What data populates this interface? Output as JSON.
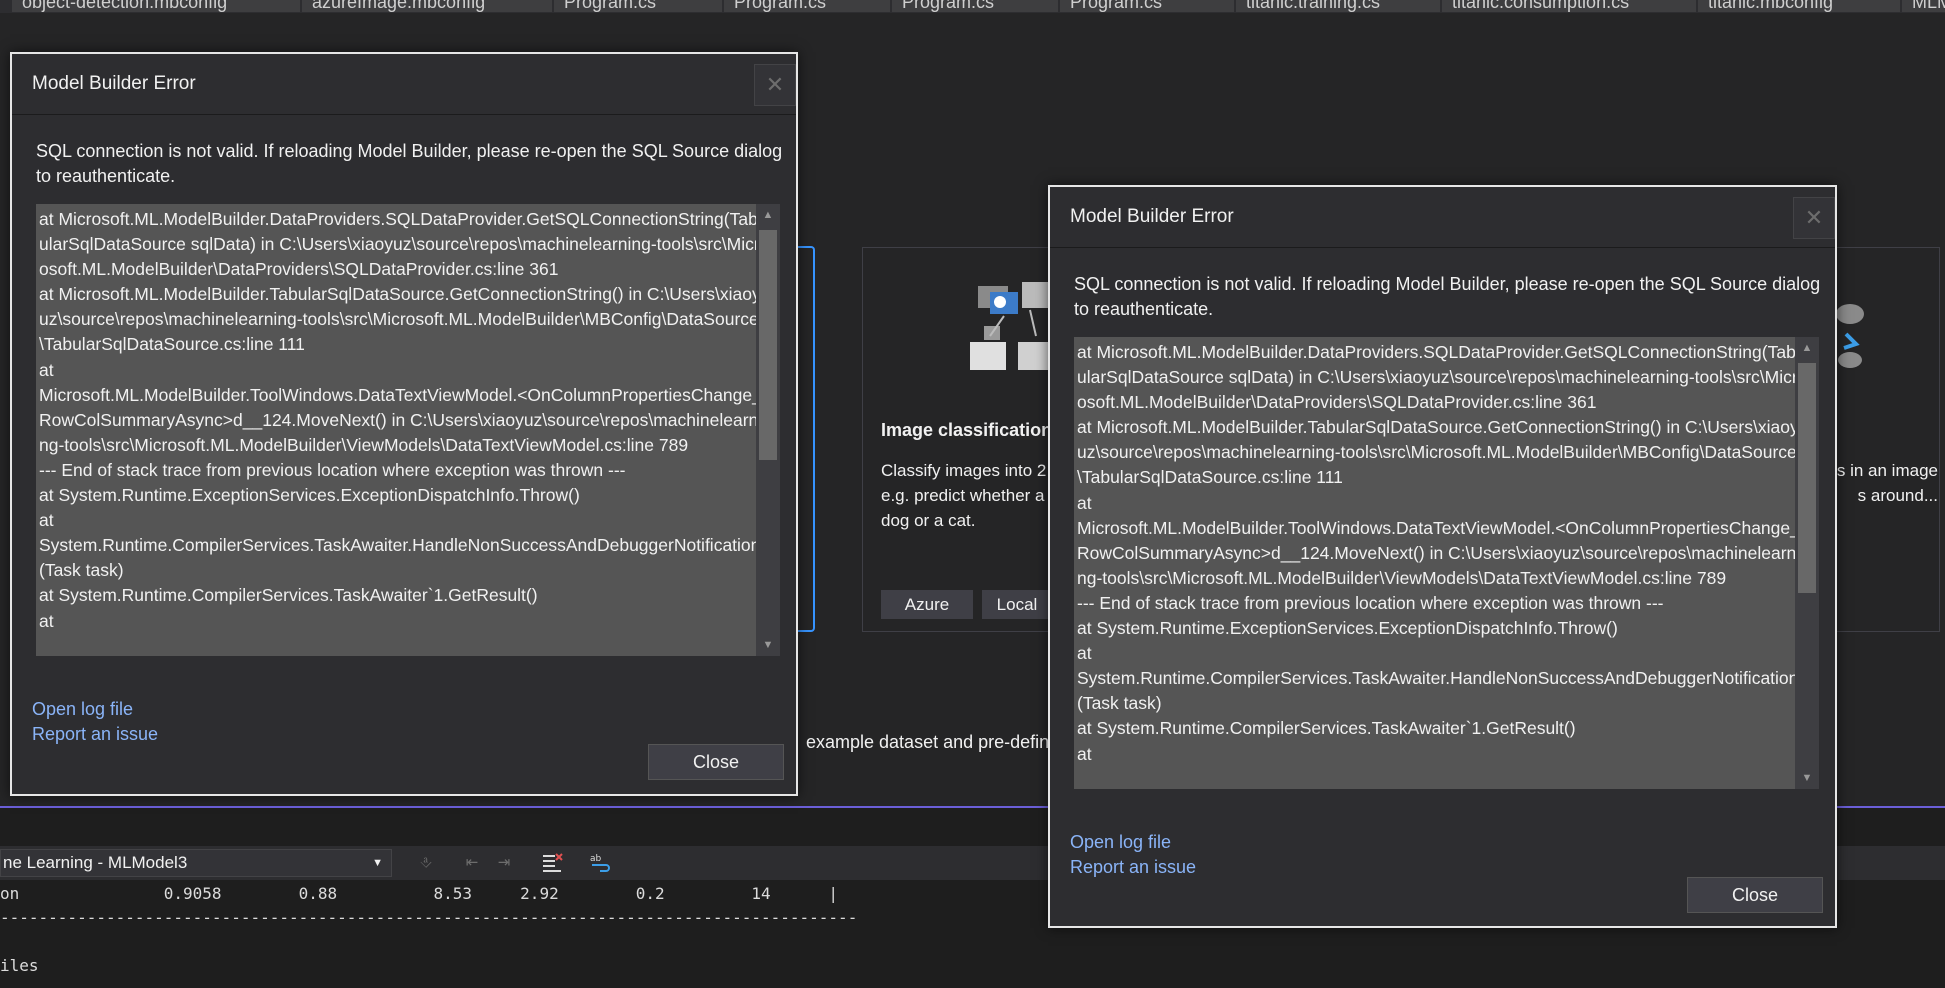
{
  "tabs": [
    "object-detection.mbconfig",
    "azureImage.mbconfig",
    "Program.cs",
    "Program.cs",
    "Program.cs",
    "Program.cs",
    "titanic.training.cs",
    "titanic.consumption.cs",
    "titanic.mbconfig",
    "MLMo"
  ],
  "background": {
    "card_title": "Image classification",
    "card_desc": "Classify images into 2 e.g. predict whether a a dog or a cat.",
    "card_right_text": "s in an image s around...",
    "azure_label": "Azure",
    "local_label": "Local",
    "example_text": "example dataset and pre-defin"
  },
  "output": {
    "source_combo": "ne Learning - MLModel3",
    "row1": "on               0.9058        0.88          8.53     2.92        0.2         14      |",
    "separator": "-----------------------------------------------------------------------------------------",
    "row2": "iles"
  },
  "dialogs": [
    {
      "title": "Model Builder Error",
      "close_x": "✕",
      "message": "SQL connection is not valid. If reloading Model Builder, please re-open the SQL Source dialog to reauthenticate.",
      "trace": [
        "   at Microsoft.ML.ModelBuilder.DataProviders.SQLDataProvider.GetSQLConnectionString(TabularSqlDataSource sqlData) in C:\\Users\\xiaoyuz\\source\\repos\\machinelearning-tools\\src\\Microsoft.ML.ModelBuilder\\DataProviders\\SQLDataProvider.cs:line 361",
        "   at Microsoft.ML.ModelBuilder.TabularSqlDataSource.GetConnectionString() in C:\\Users\\xiaoyuz\\source\\repos\\machinelearning-tools\\src\\Microsoft.ML.ModelBuilder\\MBConfig\\DataSource\\TabularSqlDataSource.cs:line 111",
        "   at",
        "Microsoft.ML.ModelBuilder.ToolWindows.DataTextViewModel.<OnColumnPropertiesChange_RowColSummaryAsync>d__124.MoveNext() in C:\\Users\\xiaoyuz\\source\\repos\\machinelearning-tools\\src\\Microsoft.ML.ModelBuilder\\ViewModels\\DataTextViewModel.cs:line 789",
        "--- End of stack trace from previous location where exception was thrown ---",
        "   at System.Runtime.ExceptionServices.ExceptionDispatchInfo.Throw()",
        "   at",
        "System.Runtime.CompilerServices.TaskAwaiter.HandleNonSuccessAndDebuggerNotification(Task task)",
        "   at System.Runtime.CompilerServices.TaskAwaiter`1.GetResult()",
        "   at"
      ],
      "open_log": "Open log file",
      "report_issue": "Report an issue",
      "close_button": "Close"
    },
    {
      "title": "Model Builder Error",
      "close_x": "✕",
      "message": "SQL connection is not valid. If reloading Model Builder, please re-open the SQL Source dialog to reauthenticate.",
      "trace": [
        "   at Microsoft.ML.ModelBuilder.DataProviders.SQLDataProvider.GetSQLConnectionString(TabularSqlDataSource sqlData) in C:\\Users\\xiaoyuz\\source\\repos\\machinelearning-tools\\src\\Microsoft.ML.ModelBuilder\\DataProviders\\SQLDataProvider.cs:line 361",
        "   at Microsoft.ML.ModelBuilder.TabularSqlDataSource.GetConnectionString() in C:\\Users\\xiaoyuz\\source\\repos\\machinelearning-tools\\src\\Microsoft.ML.ModelBuilder\\MBConfig\\DataSource\\TabularSqlDataSource.cs:line 111",
        "   at",
        "Microsoft.ML.ModelBuilder.ToolWindows.DataTextViewModel.<OnColumnPropertiesChange_RowColSummaryAsync>d__124.MoveNext() in C:\\Users\\xiaoyuz\\source\\repos\\machinelearning-tools\\src\\Microsoft.ML.ModelBuilder\\ViewModels\\DataTextViewModel.cs:line 789",
        "--- End of stack trace from previous location where exception was thrown ---",
        "   at System.Runtime.ExceptionServices.ExceptionDispatchInfo.Throw()",
        "   at",
        "System.Runtime.CompilerServices.TaskAwaiter.HandleNonSuccessAndDebuggerNotification(Task task)",
        "   at System.Runtime.CompilerServices.TaskAwaiter`1.GetResult()",
        "   at"
      ],
      "open_log": "Open log file",
      "report_issue": "Report an issue",
      "close_button": "Close"
    }
  ],
  "colors": {
    "accent_blue": "#3794ff",
    "link": "#8ab4f8",
    "status_bar_line": "#6b5fd8"
  }
}
